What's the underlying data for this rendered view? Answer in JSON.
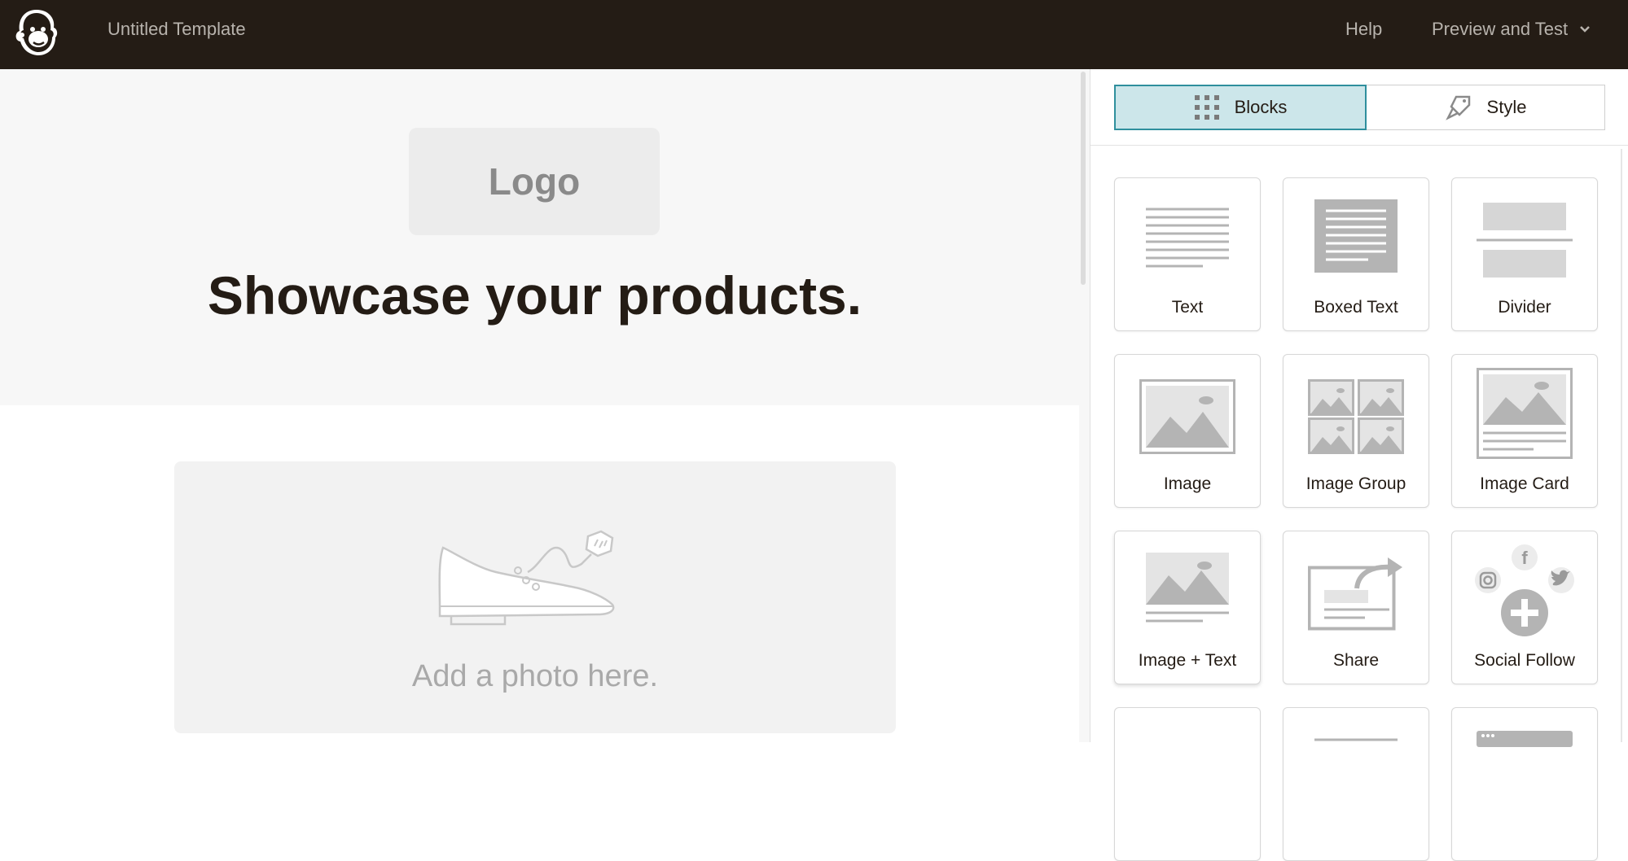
{
  "topbar": {
    "title": "Untitled Template",
    "help_label": "Help",
    "preview_label": "Preview and Test"
  },
  "canvas": {
    "logo_placeholder": "Logo",
    "headline": "Showcase your products.",
    "photo_caption": "Add a photo here."
  },
  "panel": {
    "tabs": [
      {
        "label": "Blocks",
        "icon": "grid-dots-icon",
        "active": true
      },
      {
        "label": "Style",
        "icon": "paintbrush-icon",
        "active": false
      }
    ],
    "blocks": [
      {
        "label": "Text",
        "icon": "text-block-icon"
      },
      {
        "label": "Boxed Text",
        "icon": "boxed-text-block-icon"
      },
      {
        "label": "Divider",
        "icon": "divider-block-icon"
      },
      {
        "label": "Image",
        "icon": "image-block-icon"
      },
      {
        "label": "Image Group",
        "icon": "image-group-block-icon"
      },
      {
        "label": "Image Card",
        "icon": "image-card-block-icon"
      },
      {
        "label": "Image + Text",
        "icon": "image-text-block-icon"
      },
      {
        "label": "Share",
        "icon": "share-block-icon"
      },
      {
        "label": "Social Follow",
        "icon": "social-follow-block-icon"
      }
    ]
  },
  "colors": {
    "topbar_bg": "#241c15",
    "active_tab_bg": "#cce6ea",
    "active_tab_border": "#2f8f9d",
    "icon_gray": "#b4b4b4"
  }
}
